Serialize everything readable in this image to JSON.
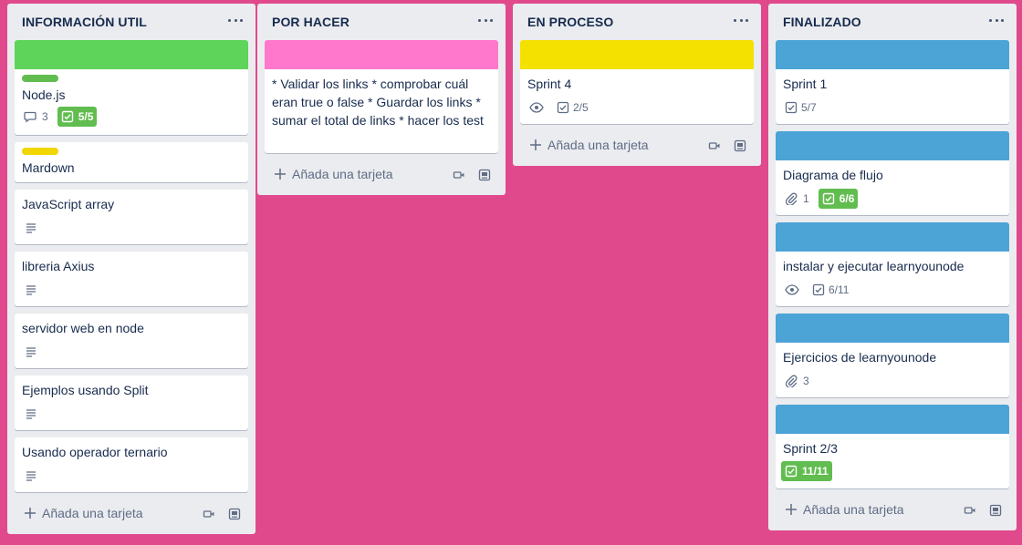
{
  "colors": {
    "board_background": "#e04a8d",
    "list_background": "#ebecf0",
    "label_green": "#61bd4f",
    "label_yellow": "#f2d600",
    "cover_green": "#5ed45a",
    "cover_pink": "#ff78cb",
    "cover_yellow": "#f5e100",
    "cover_blue": "#4ca3d6",
    "badge_complete": "#61bd4f"
  },
  "add_card_label": "Añada una tarjeta",
  "lists": [
    {
      "title": "INFORMACIÓN UTIL",
      "cards": [
        {
          "title": "Node.js",
          "cover": "green",
          "label": "green",
          "comments": "3",
          "checklist": "5/5",
          "checklist_complete": true
        },
        {
          "title": "Mardown",
          "label": "yellow"
        },
        {
          "title": "JavaScript array",
          "description": true
        },
        {
          "title": "libreria Axius",
          "description": true
        },
        {
          "title": "servidor web en node",
          "description": true
        },
        {
          "title": "Ejemplos usando Split",
          "description": true
        },
        {
          "title": "Usando operador ternario",
          "description": true
        }
      ]
    },
    {
      "title": "POR HACER",
      "cards": [
        {
          "title": "* Validar los links * comprobar cuál eran true o false * Guardar los links * sumar el total de links * hacer los test",
          "cover": "pink"
        }
      ]
    },
    {
      "title": "EN PROCESO",
      "cards": [
        {
          "title": "Sprint 4",
          "cover": "yellow",
          "watching": true,
          "checklist": "2/5"
        }
      ]
    },
    {
      "title": "FINALIZADO",
      "cards": [
        {
          "title": "Sprint 1",
          "cover": "blue",
          "checklist": "5/7"
        },
        {
          "title": "Diagrama de flujo",
          "cover": "blue",
          "attachments": "1",
          "checklist": "6/6",
          "checklist_complete": true
        },
        {
          "title": "instalar y ejecutar learnyounode",
          "cover": "blue",
          "watching": true,
          "checklist": "6/11"
        },
        {
          "title": "Ejercicios de learnyounode",
          "cover": "blue",
          "attachments": "3"
        },
        {
          "title": "Sprint 2/3",
          "cover": "blue",
          "checklist": "11/11",
          "checklist_complete": true
        }
      ]
    }
  ]
}
